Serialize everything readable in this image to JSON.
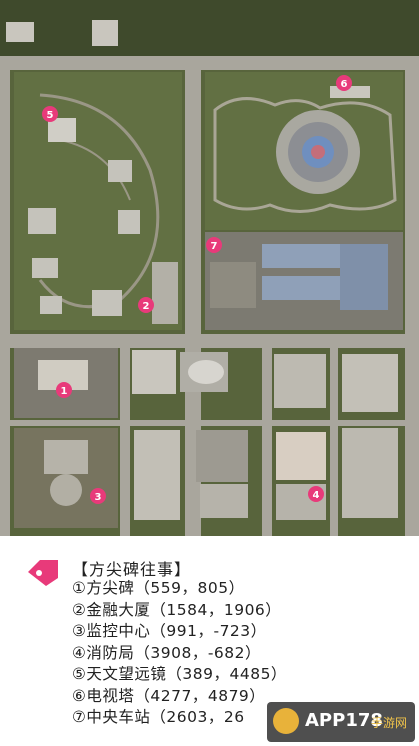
{
  "legend": {
    "title": "【方尖碑往事】",
    "items": [
      "①方尖碑（559，805）",
      "②金融大厦（1584，1906）",
      "③监控中心（991，-723）",
      "④消防局（3908，-682）",
      "⑤天文望远镜（389，4485）",
      "⑥电视塔（4277，4879）",
      "⑦中央车站（2603，26"
    ]
  },
  "markers": [
    {
      "label": "1",
      "name": "方尖碑"
    },
    {
      "label": "2",
      "name": "金融大厦"
    },
    {
      "label": "3",
      "name": "监控中心"
    },
    {
      "label": "4",
      "name": "消防局"
    },
    {
      "label": "5",
      "name": "天文望远镜"
    },
    {
      "label": "6",
      "name": "电视塔"
    },
    {
      "label": "7",
      "name": "中央车站"
    }
  ],
  "watermark": {
    "brand": "APP178",
    "sub": "手游网"
  },
  "colors": {
    "marker": "#e83a7a",
    "park": "#5d6b3f",
    "road": "#b9b6ac",
    "building": "#c9c6be"
  }
}
